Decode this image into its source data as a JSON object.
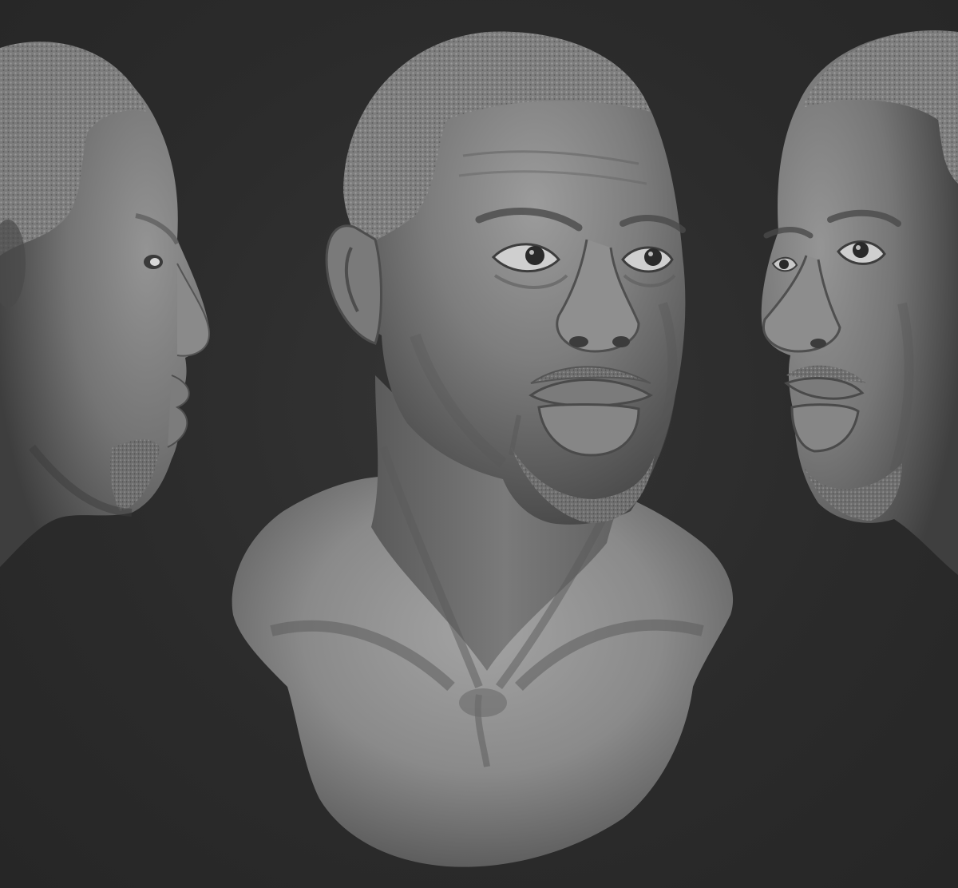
{
  "scene": {
    "description_visible_text": "",
    "background_color": "#2b2b2b",
    "material_color": "#8a8a8a",
    "views": [
      {
        "id": "left-profile",
        "orientation": "profile-right-facing"
      },
      {
        "id": "front-three-quarter",
        "orientation": "three-quarter-front"
      },
      {
        "id": "right-profile",
        "orientation": "three-quarter-left-facing"
      }
    ]
  }
}
